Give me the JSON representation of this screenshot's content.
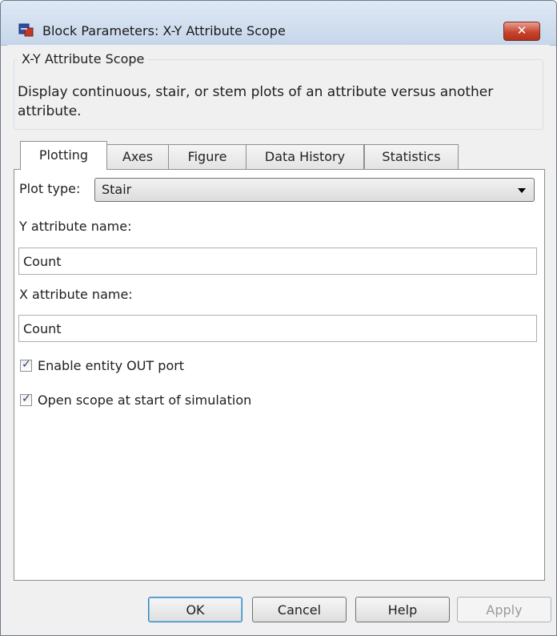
{
  "window": {
    "title": "Block Parameters: X-Y Attribute Scope",
    "close_symbol": "✕"
  },
  "group": {
    "legend": "X-Y Attribute Scope",
    "description": "Display continuous, stair, or stem plots of an attribute versus another attribute."
  },
  "tabs": [
    {
      "label": "Plotting",
      "active": true
    },
    {
      "label": "Axes"
    },
    {
      "label": "Figure"
    },
    {
      "label": "Data History"
    },
    {
      "label": "Statistics"
    }
  ],
  "plotting": {
    "plot_type_label": "Plot type:",
    "plot_type_value": "Stair",
    "y_attr_label": "Y attribute name:",
    "y_attr_value": "Count",
    "x_attr_label": "X attribute name:",
    "x_attr_value": "Count",
    "enable_out_label": "Enable entity OUT port",
    "enable_out_checked": true,
    "open_scope_label": "Open scope at start of simulation",
    "open_scope_checked": true,
    "check_mark": "✓"
  },
  "buttons": {
    "ok": "OK",
    "cancel": "Cancel",
    "help": "Help",
    "apply": "Apply"
  },
  "icons": {
    "app": "simulink-block-icon",
    "close": "close-icon",
    "dropdown": "chevron-down-icon"
  }
}
